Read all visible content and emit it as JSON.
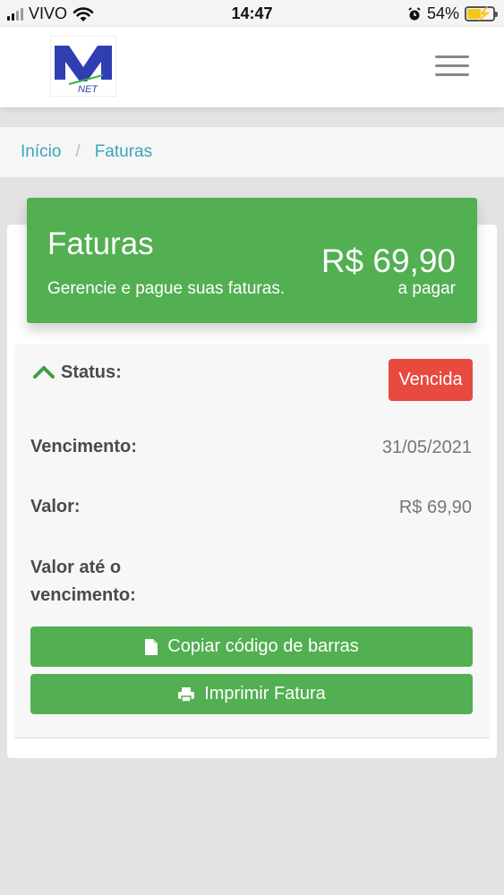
{
  "status_bar": {
    "carrier": "VIVO",
    "time": "14:47",
    "battery": "54%",
    "battery_level": 0.54,
    "icons": [
      "signal-icon",
      "wifi-icon",
      "alarm-icon",
      "battery-icon"
    ]
  },
  "header": {
    "logo_letter": "M",
    "logo_sub": "NET",
    "menu_icon": "hamburger-menu-icon"
  },
  "breadcrumb": {
    "home": "Início",
    "separator": "/",
    "current": "Faturas"
  },
  "hero": {
    "title": "Faturas",
    "subtitle": "Gerencie e pague suas faturas.",
    "amount": "R$ 69,90",
    "amount_label": "a pagar",
    "color": "#52af52"
  },
  "invoice": {
    "status_label": "Status:",
    "status_value": "Vencida",
    "status_color": "#e84a3f",
    "due_label": "Vencimento:",
    "due_value": "31/05/2021",
    "amount_label": "Valor:",
    "amount_value": "R$ 69,90",
    "amount_until_due_label_line1": "Valor até o",
    "amount_until_due_label_line2": "vencimento:"
  },
  "actions": {
    "copy_barcode": "Copiar código de barras",
    "print_invoice": "Imprimir Fatura"
  }
}
